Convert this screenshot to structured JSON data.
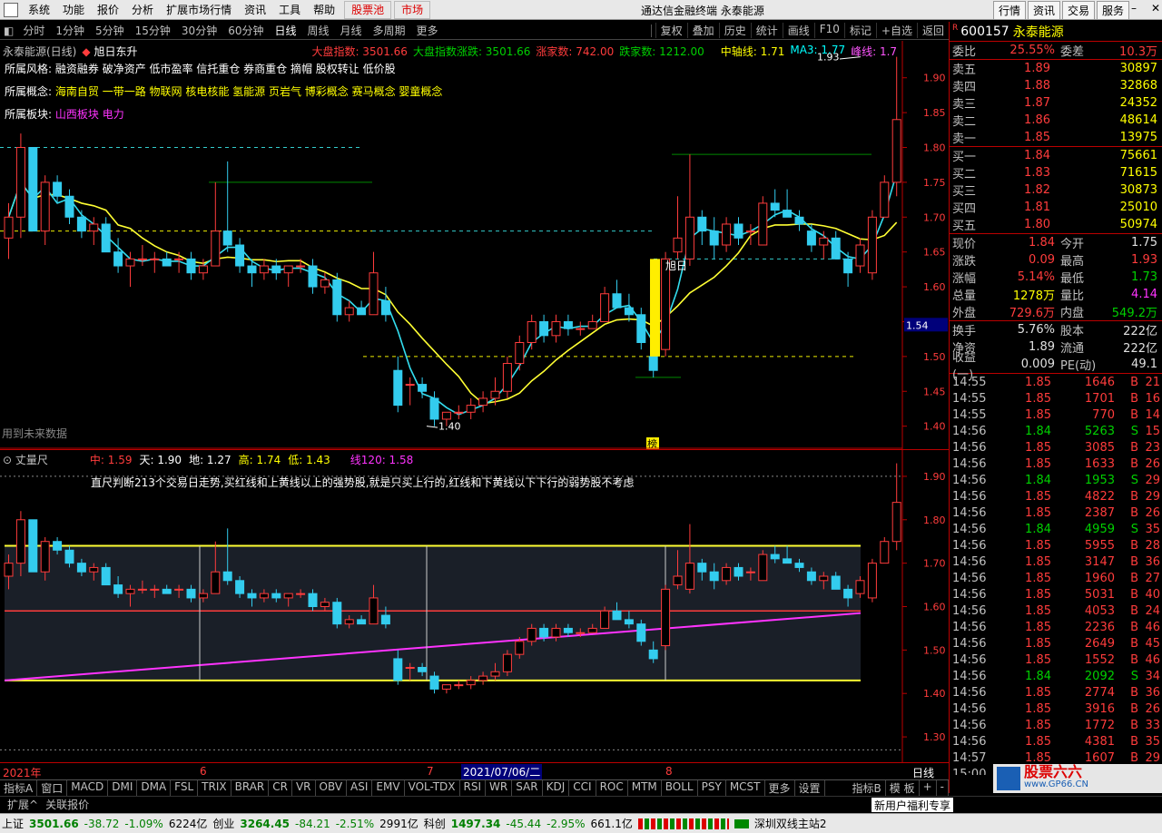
{
  "menu": [
    "系统",
    "功能",
    "报价",
    "分析",
    "扩展市场行情",
    "资讯",
    "工具",
    "帮助"
  ],
  "menu_red": [
    "股票池",
    "市场"
  ],
  "window_title": "通达信金融终端  永泰能源",
  "top_buttons": [
    "行情",
    "资讯",
    "交易",
    "服务"
  ],
  "periods": [
    "分时",
    "1分钟",
    "5分钟",
    "15分钟",
    "30分钟",
    "60分钟",
    "日线",
    "周线",
    "月线",
    "多周期",
    "更多"
  ],
  "period_selected": "日线",
  "tools": [
    "复权",
    "叠加",
    "历史",
    "统计",
    "画线",
    "F10",
    "标记",
    "+自选",
    "返回"
  ],
  "main_chart": {
    "title": "永泰能源(日线)",
    "pattern": "旭日东升",
    "market_index_label": "大盘指数: 3501.66",
    "market_index_chg": "大盘指数涨跌: 3501.66",
    "rise_count": "涨家数: 742.00",
    "fall_count": "跌家数: 1212.00",
    "mid_axis": "中轴线: 1.71",
    "ma3": "MA3: 1.77",
    "peak_line": "峰线: 1.7",
    "style_label": "所属风格:",
    "style_value": "融资融券 破净资产 低市盈率 信托重仓 券商重仓 摘帽 股权转让 低价股",
    "concept_label": "所属概念:",
    "concept_value": "海南自贸 一带一路 物联网 核电核能 氢能源 页岩气 博彩概念 赛马概念 婴童概念",
    "sector_label": "所属板块:",
    "sector_value": "山西板块 电力",
    "future_note": "用到未来数据",
    "high_label": "1.93",
    "low_label": "1.40",
    "rising_sun_label": "旭日",
    "list_badge": "榜",
    "price_box": "1.54",
    "y_ticks": [
      "1.90",
      "1.85",
      "1.80",
      "1.75",
      "1.70",
      "1.65",
      "1.60",
      "1.55",
      "1.50",
      "1.45",
      "1.40"
    ]
  },
  "sub_chart": {
    "title": "丈量尺",
    "mid": "中: 1.59",
    "sky": "天: 1.90",
    "ground": "地: 1.27",
    "high": "高: 1.74",
    "low": "低: 1.43",
    "line120": "线120: 1.58",
    "note": "直尺判断213个交易日走势,买红线和上黄线以上的强势股,就是只买上行的,红线和下黄线以下下行的弱势股不考虑",
    "y_ticks": [
      "1.90",
      "1.80",
      "1.70",
      "1.60",
      "1.50",
      "1.40",
      "1.30"
    ]
  },
  "xaxis": {
    "labels": [
      "2021年",
      "6",
      "7",
      "8"
    ],
    "cursor_date": "2021/07/06/二",
    "mode": "日线"
  },
  "chart_data": {
    "type": "candlestick",
    "title": "永泰能源(日线)",
    "ylim": [
      1.38,
      1.94
    ],
    "candles": [
      [
        1.67,
        1.72,
        1.64,
        1.7
      ],
      [
        1.7,
        1.82,
        1.67,
        1.8
      ],
      [
        1.8,
        1.8,
        1.68,
        1.68
      ],
      [
        1.68,
        1.76,
        1.66,
        1.75
      ],
      [
        1.75,
        1.76,
        1.72,
        1.73
      ],
      [
        1.73,
        1.74,
        1.69,
        1.7
      ],
      [
        1.7,
        1.71,
        1.67,
        1.68
      ],
      [
        1.68,
        1.7,
        1.66,
        1.69
      ],
      [
        1.69,
        1.7,
        1.65,
        1.65
      ],
      [
        1.65,
        1.67,
        1.62,
        1.63
      ],
      [
        1.63,
        1.65,
        1.6,
        1.64
      ],
      [
        1.64,
        1.66,
        1.63,
        1.64
      ],
      [
        1.64,
        1.65,
        1.62,
        1.64
      ],
      [
        1.64,
        1.65,
        1.63,
        1.63
      ],
      [
        1.64,
        1.65,
        1.62,
        1.64
      ],
      [
        1.64,
        1.65,
        1.61,
        1.62
      ],
      [
        1.62,
        1.64,
        1.61,
        1.63
      ],
      [
        1.63,
        1.75,
        1.63,
        1.68
      ],
      [
        1.68,
        1.78,
        1.65,
        1.66
      ],
      [
        1.66,
        1.67,
        1.62,
        1.63
      ],
      [
        1.63,
        1.64,
        1.6,
        1.62
      ],
      [
        1.62,
        1.64,
        1.61,
        1.63
      ],
      [
        1.63,
        1.64,
        1.61,
        1.62
      ],
      [
        1.62,
        1.63,
        1.6,
        1.63
      ],
      [
        1.63,
        1.64,
        1.62,
        1.63
      ],
      [
        1.63,
        1.64,
        1.59,
        1.6
      ],
      [
        1.6,
        1.62,
        1.59,
        1.61
      ],
      [
        1.61,
        1.62,
        1.55,
        1.56
      ],
      [
        1.56,
        1.58,
        1.55,
        1.57
      ],
      [
        1.57,
        1.58,
        1.56,
        1.56
      ],
      [
        1.56,
        1.65,
        1.56,
        1.62
      ],
      [
        1.58,
        1.6,
        1.55,
        1.56
      ],
      [
        1.48,
        1.5,
        1.42,
        1.43
      ],
      [
        1.46,
        1.47,
        1.43,
        1.46
      ],
      [
        1.46,
        1.47,
        1.44,
        1.45
      ],
      [
        1.44,
        1.45,
        1.4,
        1.41
      ],
      [
        1.41,
        1.42,
        1.4,
        1.42
      ],
      [
        1.42,
        1.43,
        1.41,
        1.42
      ],
      [
        1.42,
        1.44,
        1.41,
        1.43
      ],
      [
        1.43,
        1.45,
        1.42,
        1.44
      ],
      [
        1.44,
        1.47,
        1.43,
        1.45
      ],
      [
        1.45,
        1.5,
        1.44,
        1.49
      ],
      [
        1.49,
        1.53,
        1.48,
        1.52
      ],
      [
        1.52,
        1.56,
        1.51,
        1.55
      ],
      [
        1.55,
        1.56,
        1.52,
        1.53
      ],
      [
        1.53,
        1.56,
        1.52,
        1.55
      ],
      [
        1.55,
        1.56,
        1.53,
        1.54
      ],
      [
        1.54,
        1.55,
        1.53,
        1.54
      ],
      [
        1.54,
        1.56,
        1.54,
        1.55
      ],
      [
        1.55,
        1.6,
        1.55,
        1.59
      ],
      [
        1.59,
        1.61,
        1.57,
        1.57
      ],
      [
        1.57,
        1.59,
        1.55,
        1.56
      ],
      [
        1.56,
        1.57,
        1.51,
        1.52
      ],
      [
        1.5,
        1.52,
        1.47,
        1.48
      ],
      [
        1.51,
        1.65,
        1.5,
        1.64
      ],
      [
        1.65,
        1.73,
        1.64,
        1.67
      ],
      [
        1.64,
        1.79,
        1.63,
        1.7
      ],
      [
        1.7,
        1.71,
        1.66,
        1.68
      ],
      [
        1.68,
        1.7,
        1.64,
        1.66
      ],
      [
        1.66,
        1.7,
        1.65,
        1.69
      ],
      [
        1.69,
        1.7,
        1.66,
        1.67
      ],
      [
        1.68,
        1.69,
        1.66,
        1.68
      ],
      [
        1.66,
        1.73,
        1.66,
        1.72
      ],
      [
        1.72,
        1.74,
        1.7,
        1.71
      ],
      [
        1.71,
        1.74,
        1.7,
        1.7
      ],
      [
        1.7,
        1.71,
        1.68,
        1.69
      ],
      [
        1.68,
        1.69,
        1.65,
        1.66
      ],
      [
        1.66,
        1.68,
        1.64,
        1.67
      ],
      [
        1.67,
        1.68,
        1.64,
        1.64
      ],
      [
        1.64,
        1.65,
        1.6,
        1.62
      ],
      [
        1.63,
        1.67,
        1.62,
        1.66
      ],
      [
        1.62,
        1.71,
        1.61,
        1.7
      ],
      [
        1.7,
        1.76,
        1.7,
        1.75
      ],
      [
        1.75,
        1.93,
        1.73,
        1.84
      ]
    ]
  },
  "quote": {
    "code": "600157",
    "name": "永泰能源",
    "weibi_label": "委比",
    "weibi": "25.55%",
    "weicha_label": "委差",
    "weicha": "10.3万",
    "asks": [
      {
        "label": "卖五",
        "price": "1.89",
        "vol": "30897"
      },
      {
        "label": "卖四",
        "price": "1.88",
        "vol": "32868"
      },
      {
        "label": "卖三",
        "price": "1.87",
        "vol": "24352"
      },
      {
        "label": "卖二",
        "price": "1.86",
        "vol": "48614"
      },
      {
        "label": "卖一",
        "price": "1.85",
        "vol": "13975"
      }
    ],
    "bids": [
      {
        "label": "买一",
        "price": "1.84",
        "vol": "75661"
      },
      {
        "label": "买二",
        "price": "1.83",
        "vol": "71615"
      },
      {
        "label": "买三",
        "price": "1.82",
        "vol": "30873"
      },
      {
        "label": "买四",
        "price": "1.81",
        "vol": "25010"
      },
      {
        "label": "买五",
        "price": "1.80",
        "vol": "50974"
      }
    ],
    "stats": [
      [
        {
          "l": "现价",
          "v": "1.84",
          "c": "red"
        },
        {
          "l": "今开",
          "v": "1.75",
          "c": "wht"
        }
      ],
      [
        {
          "l": "涨跌",
          "v": "0.09",
          "c": "red"
        },
        {
          "l": "最高",
          "v": "1.93",
          "c": "red"
        }
      ],
      [
        {
          "l": "涨幅",
          "v": "5.14%",
          "c": "red"
        },
        {
          "l": "最低",
          "v": "1.73",
          "c": "grn"
        }
      ],
      [
        {
          "l": "总量",
          "v": "1278万",
          "c": "yel"
        },
        {
          "l": "量比",
          "v": "4.14",
          "c": "mag"
        }
      ],
      [
        {
          "l": "外盘",
          "v": "729.6万",
          "c": "red"
        },
        {
          "l": "内盘",
          "v": "549.2万",
          "c": "grn"
        }
      ]
    ],
    "stats2": [
      [
        {
          "l": "换手",
          "v": "5.76%",
          "c": "wht"
        },
        {
          "l": "股本",
          "v": "222亿",
          "c": "wht"
        }
      ],
      [
        {
          "l": "净资",
          "v": "1.89",
          "c": "wht"
        },
        {
          "l": "流通",
          "v": "222亿",
          "c": "wht"
        }
      ],
      [
        {
          "l": "收益(一)",
          "v": "0.009",
          "c": "wht"
        },
        {
          "l": "PE(动)",
          "v": "49.1",
          "c": "wht"
        }
      ]
    ],
    "ticks": [
      [
        "14:55",
        "1.85",
        "1646",
        "B",
        "21"
      ],
      [
        "14:55",
        "1.85",
        "1701",
        "B",
        "16"
      ],
      [
        "14:55",
        "1.85",
        "770",
        "B",
        "14"
      ],
      [
        "14:56",
        "1.84",
        "5263",
        "S",
        "15"
      ],
      [
        "14:56",
        "1.85",
        "3085",
        "B",
        "23"
      ],
      [
        "14:56",
        "1.85",
        "1633",
        "B",
        "26"
      ],
      [
        "14:56",
        "1.84",
        "1953",
        "S",
        "29"
      ],
      [
        "14:56",
        "1.85",
        "4822",
        "B",
        "29"
      ],
      [
        "14:56",
        "1.85",
        "2387",
        "B",
        "26"
      ],
      [
        "14:56",
        "1.84",
        "4959",
        "S",
        "35"
      ],
      [
        "14:56",
        "1.85",
        "5955",
        "B",
        "28"
      ],
      [
        "14:56",
        "1.85",
        "3147",
        "B",
        "36"
      ],
      [
        "14:56",
        "1.85",
        "1960",
        "B",
        "27"
      ],
      [
        "14:56",
        "1.85",
        "5031",
        "B",
        "40"
      ],
      [
        "14:56",
        "1.85",
        "4053",
        "B",
        "24"
      ],
      [
        "14:56",
        "1.85",
        "2236",
        "B",
        "46"
      ],
      [
        "14:56",
        "1.85",
        "2649",
        "B",
        "45"
      ],
      [
        "14:56",
        "1.85",
        "1552",
        "B",
        "46"
      ],
      [
        "14:56",
        "1.84",
        "2092",
        "S",
        "34"
      ],
      [
        "14:56",
        "1.85",
        "2774",
        "B",
        "36"
      ],
      [
        "14:56",
        "1.85",
        "3916",
        "B",
        "26"
      ],
      [
        "14:56",
        "1.85",
        "1772",
        "B",
        "33"
      ],
      [
        "14:56",
        "1.85",
        "4381",
        "B",
        "35"
      ],
      [
        "14:57",
        "1.85",
        "1607",
        "B",
        "29"
      ]
    ],
    "ticks_last_time": "15:00"
  },
  "indicator_tabs": [
    "指标A",
    "窗口",
    "MACD",
    "DMI",
    "DMA",
    "FSL",
    "TRIX",
    "BRAR",
    "CR",
    "VR",
    "OBV",
    "ASI",
    "EMV",
    "VOL-TDX",
    "RSI",
    "WR",
    "SAR",
    "KDJ",
    "CCI",
    "ROC",
    "MTM",
    "BOLL",
    "PSY",
    "MCST",
    "更多",
    "设置"
  ],
  "indicator_b": [
    "指标B",
    "模 板",
    "+",
    "-"
  ],
  "ext_tabs": [
    "扩展^",
    "关联报价"
  ],
  "promo": "新用户福利专享",
  "status": {
    "sh_label": "上证",
    "sh": "3501.66",
    "sh_chg": "-38.72",
    "sh_pct": "-1.09%",
    "sh_amt": "6224亿",
    "cy_label": "创业",
    "cy": "3264.45",
    "cy_chg": "-84.21",
    "cy_pct": "-2.51%",
    "cy_amt": "2991亿",
    "kc_label": "科创",
    "kc": "1497.34",
    "kc_chg": "-45.44",
    "kc_pct": "-2.95%",
    "kc_amt": "661.1亿",
    "server": "深圳双线主站2"
  },
  "watermark": "股票六六",
  "watermark_url": "www.GP66.CN"
}
